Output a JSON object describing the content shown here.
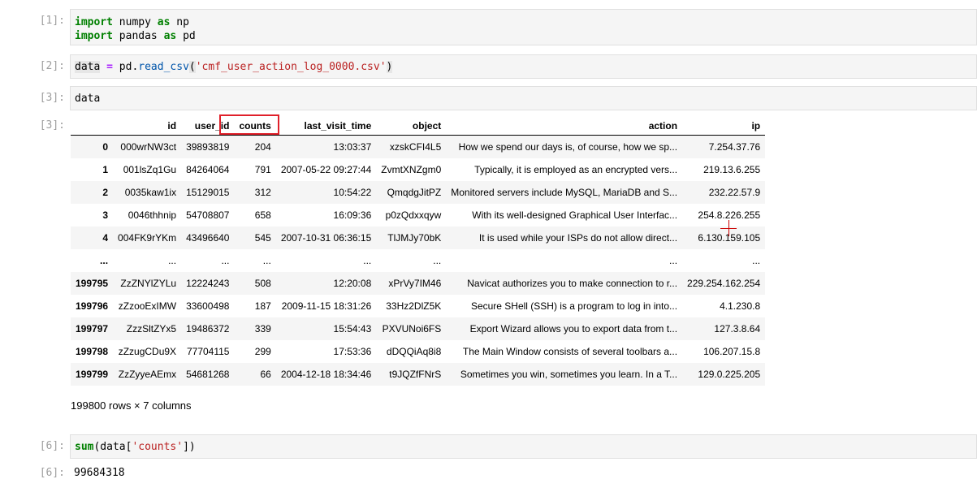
{
  "cells": [
    {
      "prompt": "[1]:",
      "code_lines": [
        {
          "kw": "import",
          "a": " numpy ",
          "kw2": "as",
          "b": " np"
        },
        {
          "kw": "import",
          "a": " pandas ",
          "kw2": "as",
          "b": " pd"
        }
      ]
    },
    {
      "prompt": "[2]:",
      "var": "data",
      "eq": " = ",
      "obj": "pd.",
      "fn": "read_csv",
      "open": "(",
      "str": "'cmf_user_action_log_0000.csv'",
      "close": ")"
    },
    {
      "prompt": "[3]:",
      "code": "data"
    },
    {
      "prompt": "[6]:",
      "fn": "sum",
      "rest_a": "(data[",
      "str": "'counts'",
      "rest_b": "])"
    }
  ],
  "output_prompts": {
    "out3": "[3]:",
    "out6": "[6]:"
  },
  "dataframe": {
    "columns": [
      "",
      "id",
      "user_id",
      "counts",
      "last_visit_time",
      "object",
      "action",
      "ip"
    ],
    "rows": [
      [
        "0",
        "000wrNW3ct",
        "39893819",
        "204",
        "13:03:37",
        "xzskCFI4L5",
        "How we spend our days is, of course, how we sp...",
        "7.254.37.76"
      ],
      [
        "1",
        "001lsZq1Gu",
        "84264064",
        "791",
        "2007-05-22 09:27:44",
        "ZvmtXNZgm0",
        "Typically, it is employed as an encrypted vers...",
        "219.13.6.255"
      ],
      [
        "2",
        "0035kaw1ix",
        "15129015",
        "312",
        "10:54:22",
        "QmqdgJitPZ",
        "Monitored servers include MySQL, MariaDB and S...",
        "232.22.57.9"
      ],
      [
        "3",
        "0046thhnip",
        "54708807",
        "658",
        "16:09:36",
        "p0zQdxxqyw",
        "With its well-designed Graphical User Interfac...",
        "254.8.226.255"
      ],
      [
        "4",
        "004FK9rYKm",
        "43496640",
        "545",
        "2007-10-31 06:36:15",
        "TlJMJy70bK",
        "It is used while your ISPs do not allow direct...",
        "6.130.159.105"
      ],
      [
        "...",
        "...",
        "...",
        "...",
        "...",
        "...",
        "...",
        "..."
      ],
      [
        "199795",
        "ZzZNYlZYLu",
        "12224243",
        "508",
        "12:20:08",
        "xPrVy7IM46",
        "Navicat authorizes you to make connection to r...",
        "229.254.162.254"
      ],
      [
        "199796",
        "zZzooExIMW",
        "33600498",
        "187",
        "2009-11-15 18:31:26",
        "33Hz2DlZ5K",
        "Secure SHell (SSH) is a program to log in into...",
        "4.1.230.8"
      ],
      [
        "199797",
        "ZzzSltZYx5",
        "19486372",
        "339",
        "15:54:43",
        "PXVUNoi6FS",
        "Export Wizard allows you to export data from t...",
        "127.3.8.64"
      ],
      [
        "199798",
        "zZzugCDu9X",
        "77704115",
        "299",
        "17:53:36",
        "dDQQiAq8i8",
        "The Main Window consists of several toolbars a...",
        "106.207.15.8"
      ],
      [
        "199799",
        "ZzZyyeAEmx",
        "54681268",
        "66",
        "2004-12-18 18:34:46",
        "t9JQZfFNrS",
        "Sometimes you win, sometimes you learn. In a T...",
        "129.0.225.205"
      ]
    ],
    "shape_text": "199800 rows × 7 columns"
  },
  "sum_output": "99684318"
}
